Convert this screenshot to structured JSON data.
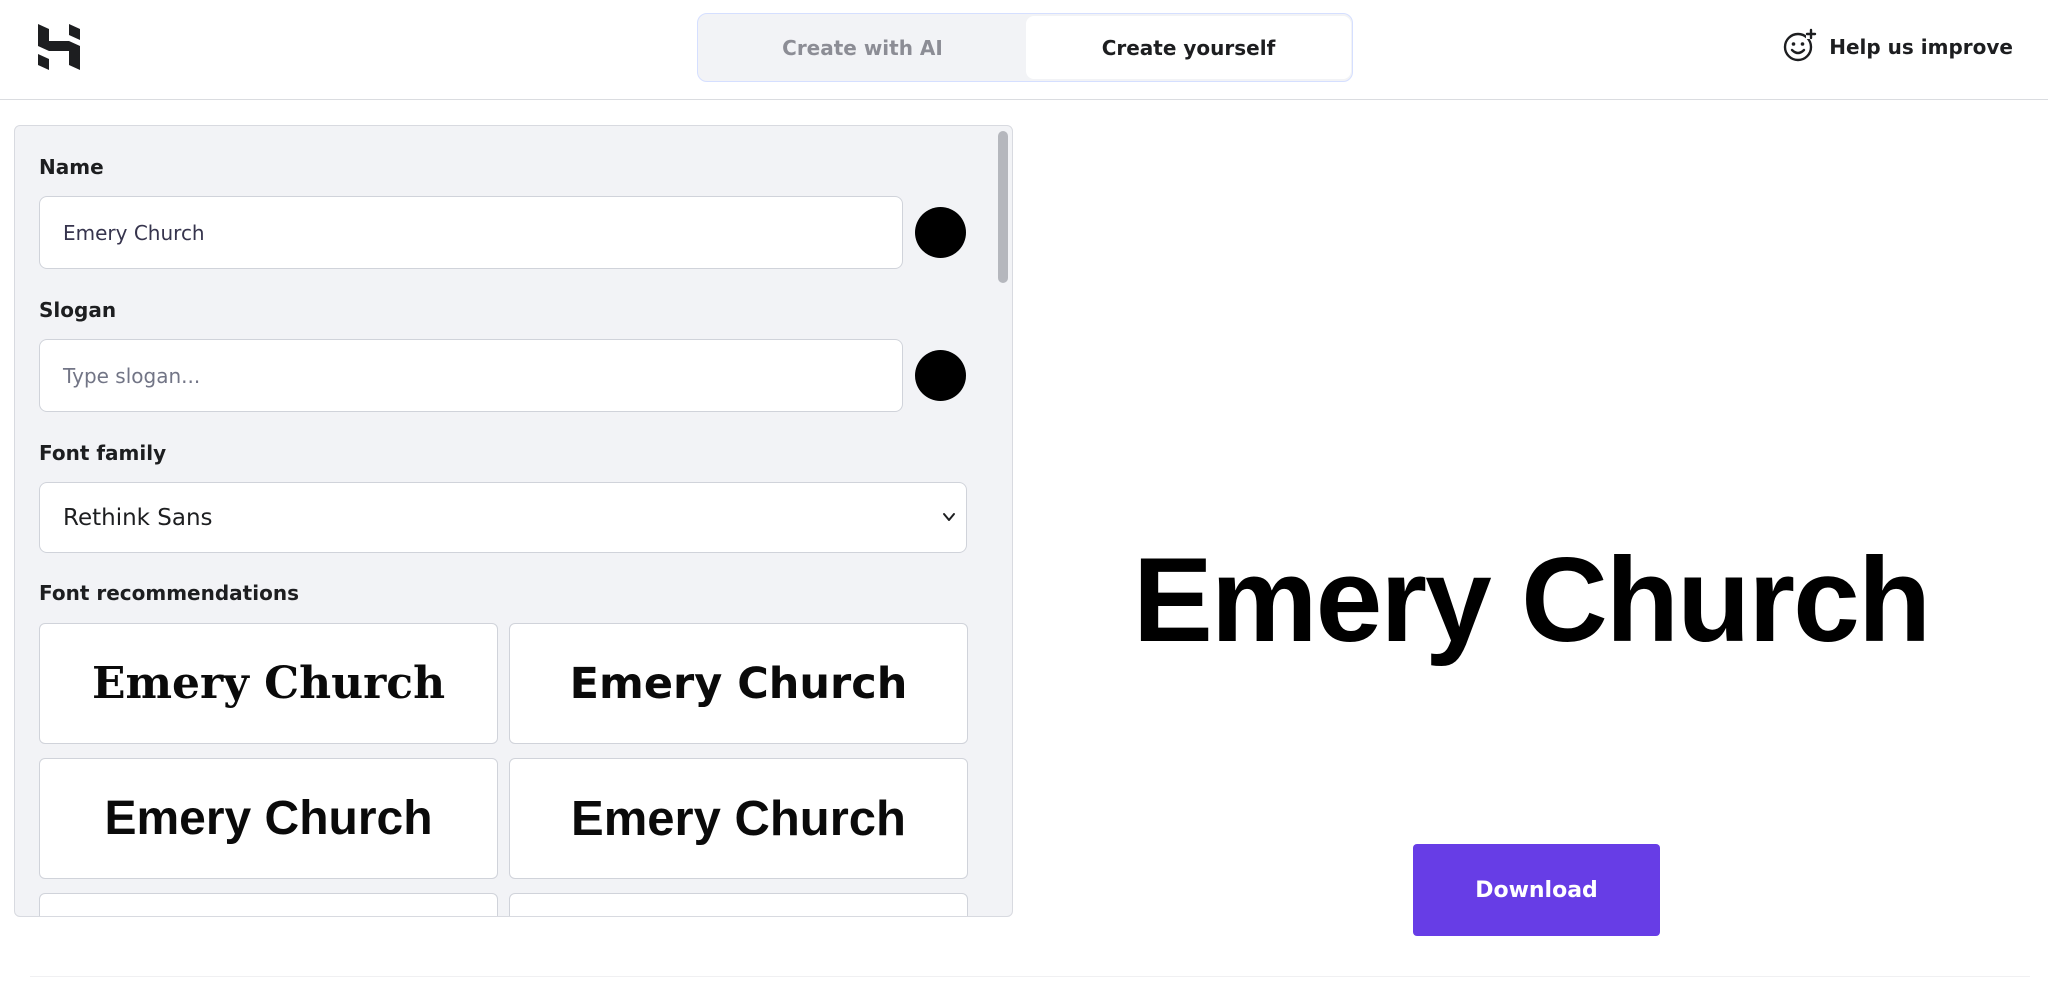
{
  "header": {
    "logo_icon": "hostinger-logo-icon",
    "tabs": [
      {
        "label": "Create with AI",
        "active": false
      },
      {
        "label": "Create yourself",
        "active": true
      }
    ],
    "help": {
      "label": "Help us improve",
      "icon": "smiley-plus-icon"
    }
  },
  "form": {
    "name": {
      "label": "Name",
      "value": "Emery Church",
      "color": "#000000"
    },
    "slogan": {
      "label": "Slogan",
      "placeholder": "Type slogan...",
      "value": "",
      "color": "#000000"
    },
    "font_family": {
      "label": "Font family",
      "selected": "Rethink Sans"
    },
    "recommendations": {
      "label": "Font recommendations",
      "items": [
        "Emery Church",
        "Emery Church",
        "Emery Church",
        "Emery Church"
      ]
    }
  },
  "preview": {
    "name": "Emery Church",
    "download_label": "Download"
  },
  "colors": {
    "accent": "#673de6",
    "panel_bg": "#f2f3f6"
  }
}
